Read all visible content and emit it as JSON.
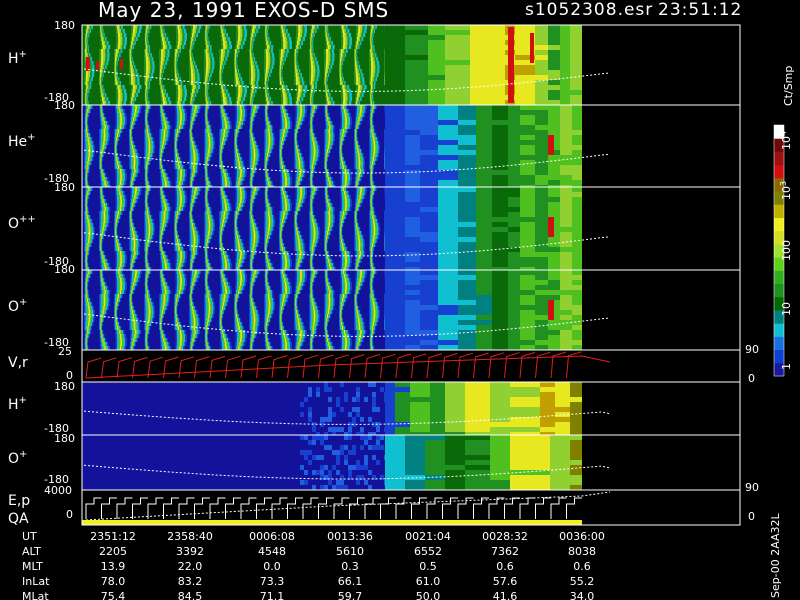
{
  "header": {
    "title": "May 23, 1991    EXOS-D SMS",
    "file": "s1052308.esr",
    "time": "23:51:12"
  },
  "panels": [
    {
      "label": "H",
      "sup": "+",
      "ymax": "180",
      "ymin": "-180"
    },
    {
      "label": "He",
      "sup": "+",
      "ymax": "180",
      "ymin": "-180"
    },
    {
      "label": "O",
      "sup": "++",
      "ymax": "180",
      "ymin": "-180"
    },
    {
      "label": "O",
      "sup": "+",
      "ymax": "180",
      "ymin": "-180"
    },
    {
      "label": "V,r",
      "sup": "",
      "ymax": "25",
      "ymin": "0",
      "right_max": "90",
      "right_min": "0"
    },
    {
      "label": "H",
      "sup": "+",
      "ymax": "180",
      "ymin": "-180"
    },
    {
      "label": "O",
      "sup": "+",
      "ymax": "180",
      "ymin": "-180"
    },
    {
      "label": "E,p",
      "label2": "QA",
      "ymax": "4000",
      "ymin": "0",
      "right_max": "90",
      "right_min": "0"
    }
  ],
  "colorbar": {
    "unit": "Ct/Smp",
    "ticks": [
      "10",
      "10",
      "100",
      "10",
      "1"
    ],
    "tick_sups": [
      "4",
      "3",
      "",
      "",
      ""
    ],
    "colors": [
      "#1a1aa0",
      "#1040d0",
      "#1a70e0",
      "#10c0d0",
      "#008080",
      "#006a00",
      "#209020",
      "#30b020",
      "#60d020",
      "#a0e030",
      "#d0e020",
      "#f0f020",
      "#c0b000",
      "#808000",
      "#8a6a00",
      "#d01010",
      "#a01010",
      "#700a0a",
      "#ffffff"
    ]
  },
  "footer": {
    "vertical_label": "Sep-00  2AA32L",
    "rows": [
      {
        "name": "UT",
        "values": [
          "2351:12",
          "2358:40",
          "0006:08",
          "0013:36",
          "0021:04",
          "0028:32",
          "0036:00"
        ]
      },
      {
        "name": "ALT",
        "values": [
          "2205",
          "3392",
          "4548",
          "5610",
          "6552",
          "7362",
          "8038"
        ]
      },
      {
        "name": "MLT",
        "values": [
          "13.9",
          "22.0",
          "0.0",
          "0.3",
          "0.5",
          "0.6",
          "0.6"
        ]
      },
      {
        "name": "InLat",
        "values": [
          "78.0",
          "83.2",
          "73.3",
          "66.1",
          "61.0",
          "57.6",
          "55.2"
        ]
      },
      {
        "name": "MLat",
        "values": [
          "75.4",
          "84.5",
          "71.1",
          "59.7",
          "50.0",
          "41.6",
          "34.0"
        ]
      }
    ]
  },
  "chart_data": {
    "type": "heatmap",
    "title": "May 23, 1991    EXOS-D SMS",
    "x_ut": [
      "2351:12",
      "2358:40",
      "0006:08",
      "0013:36",
      "0021:04",
      "0028:32",
      "0036:00"
    ],
    "colorbar_range": [
      1,
      10000
    ],
    "colorbar_scale": "log",
    "colorbar_label": "Ct/Smp",
    "series": [
      {
        "name": "H+",
        "ylim": [
          -180,
          180
        ]
      },
      {
        "name": "He+",
        "ylim": [
          -180,
          180
        ]
      },
      {
        "name": "O++",
        "ylim": [
          -180,
          180
        ]
      },
      {
        "name": "O+",
        "ylim": [
          -180,
          180
        ]
      },
      {
        "name": "V,r",
        "ylim": [
          0,
          25
        ],
        "ylim_right": [
          0,
          90
        ]
      },
      {
        "name": "H+",
        "ylim": [
          -180,
          180
        ]
      },
      {
        "name": "O+",
        "ylim": [
          -180,
          180
        ]
      },
      {
        "name": "E,p / QA",
        "ylim": [
          0,
          4000
        ],
        "ylim_right": [
          0,
          90
        ]
      }
    ]
  }
}
